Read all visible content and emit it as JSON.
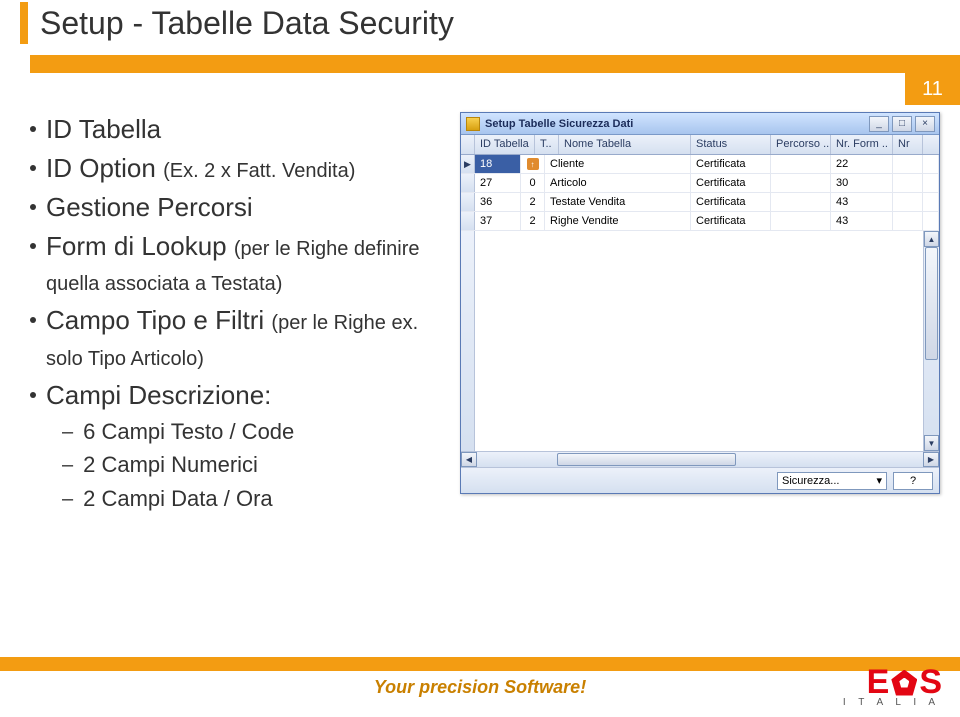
{
  "slide": {
    "title": "Setup - Tabelle Data Security",
    "page_number": "11"
  },
  "bullets": [
    {
      "text": "ID Tabella"
    },
    {
      "text": "ID Option ",
      "small": "(Ex. 2 x Fatt. Vendita)"
    },
    {
      "text": "Gestione Percorsi"
    },
    {
      "text": "Form di Lookup ",
      "small": "(per le Righe definire quella associata a Testata)"
    },
    {
      "text": "Campo Tipo e Filtri ",
      "small": "(per le Righe ex. solo Tipo Articolo)"
    },
    {
      "text": "Campi Descrizione:",
      "children": [
        "6 Campi Testo / Code",
        "2 Campi Numerici",
        "2 Campi Data / Ora"
      ]
    }
  ],
  "window": {
    "title": "Setup Tabelle Sicurezza Dati",
    "columns": [
      "ID Tabella",
      "T..",
      "Nome Tabella",
      "Status",
      "Percorso ..",
      "Nr. Form ..",
      "Nr"
    ],
    "rows": [
      {
        "id": "18",
        "t": "",
        "bool": true,
        "nome": "Cliente",
        "status": "Certificata",
        "nrform": "22"
      },
      {
        "id": "27",
        "t": "0",
        "bool": false,
        "nome": "Articolo",
        "status": "Certificata",
        "nrform": "30"
      },
      {
        "id": "36",
        "t": "2",
        "bool": false,
        "nome": "Testate Vendita",
        "status": "Certificata",
        "nrform": "43"
      },
      {
        "id": "37",
        "t": "2",
        "bool": false,
        "nome": "Righe Vendite",
        "status": "Certificata",
        "nrform": "43"
      }
    ],
    "footer": {
      "sicurezza_label": "Sicurezza...",
      "help_label": "?"
    }
  },
  "footer": {
    "slogan": "Your precision Software!",
    "logo_text": {
      "e": "E",
      "s": "S",
      "sub": "I T A L I A"
    }
  }
}
